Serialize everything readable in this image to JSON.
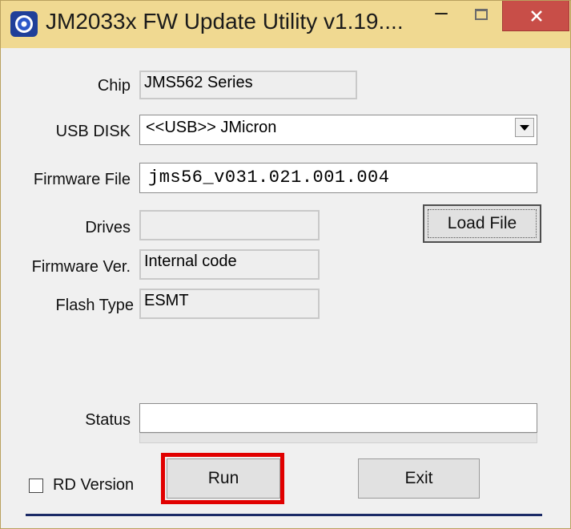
{
  "window": {
    "title": "JM2033x FW Update Utility v1.19...."
  },
  "form": {
    "chip": {
      "label": "Chip",
      "value": "JMS562 Series"
    },
    "usb_disk": {
      "label": "USB DISK",
      "value": "<<USB>> JMicron"
    },
    "firmware_file": {
      "label": "Firmware File",
      "value": "jms56_v031.021.001.004"
    },
    "drives": {
      "label": "Drives",
      "value": ""
    },
    "firmware_ver": {
      "label": "Firmware Ver.",
      "value": "Internal code"
    },
    "flash_type": {
      "label": "Flash Type",
      "value": "ESMT"
    },
    "status": {
      "label": "Status",
      "value": ""
    },
    "progress_fraction": 0
  },
  "buttons": {
    "load_file": "Load File",
    "run": "Run",
    "exit": "Exit"
  },
  "options": {
    "rd_version": {
      "label": "RD Version",
      "checked": false
    }
  },
  "colors": {
    "titlebar": "#f0d991",
    "close": "#c84e48",
    "highlight": "#e10000"
  }
}
